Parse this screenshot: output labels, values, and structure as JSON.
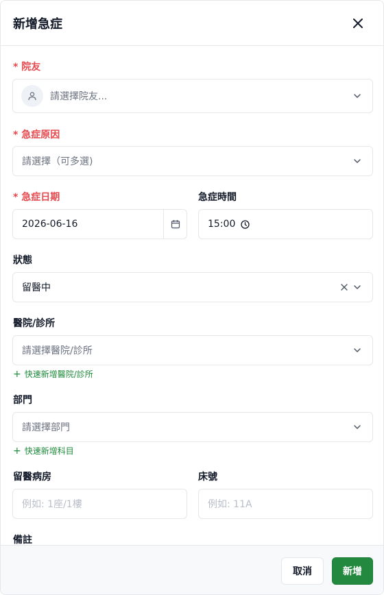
{
  "modal": {
    "title": "新增急症",
    "close_icon": "close-icon"
  },
  "form": {
    "resident": {
      "label": "* 院友",
      "placeholder": "請選擇院友..."
    },
    "reason": {
      "label": "* 急症原因",
      "placeholder": "請選擇（可多選)"
    },
    "date": {
      "label": "* 急症日期",
      "value": "2026-06-16"
    },
    "time": {
      "label": "急症時間",
      "value": "15:00"
    },
    "status": {
      "label": "狀態",
      "value": "留醫中"
    },
    "hospital": {
      "label": "醫院/診所",
      "placeholder": "請選擇醫院/診所",
      "quick_add": "快速新增醫院/診所"
    },
    "department": {
      "label": "部門",
      "placeholder": "請選擇部門",
      "quick_add": "快速新增科目"
    },
    "ward": {
      "label": "留醫病房",
      "placeholder": "例如: 1座/1樓"
    },
    "bed": {
      "label": "床號",
      "placeholder": "例如: 11A"
    },
    "notes": {
      "label": "備註"
    }
  },
  "footer": {
    "cancel_label": "取消",
    "submit_label": "新增"
  },
  "colors": {
    "required": "#e5484d",
    "primary": "#22893e",
    "link": "#1f8a3b"
  }
}
